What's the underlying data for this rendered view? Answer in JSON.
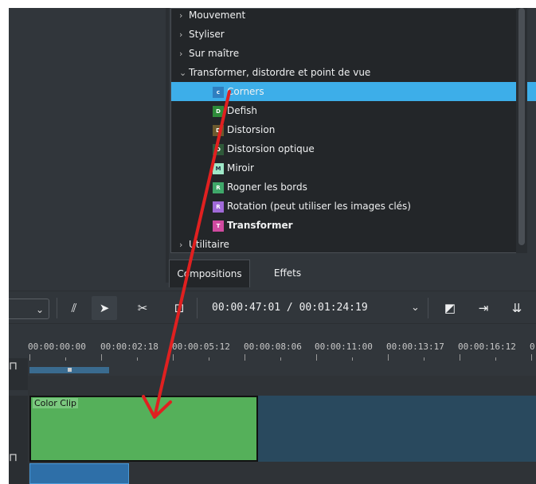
{
  "effects_tree": {
    "categories_top": [
      {
        "label": "Mouvement"
      },
      {
        "label": "Styliser"
      },
      {
        "label": "Sur maître"
      },
      {
        "label": "Transformer, distordre et point de vue"
      }
    ],
    "items": [
      {
        "label": "Corners",
        "icon_text": "c",
        "icon_color": "#2f7fc0",
        "selected": true
      },
      {
        "label": "Defish",
        "icon_text": "D",
        "icon_color": "#2e8b3a"
      },
      {
        "label": "Distorsion",
        "icon_text": "D",
        "icon_color": "#6b5a2e"
      },
      {
        "label": "Distorsion optique",
        "icon_text": "D",
        "icon_color": "#2f5a3a"
      },
      {
        "label": "Miroir",
        "icon_text": "M",
        "icon_color": "#9fe8c8"
      },
      {
        "label": "Rogner les bords",
        "icon_text": "R",
        "icon_color": "#3fa86a"
      },
      {
        "label": "Rotation (peut utiliser les images clés)",
        "icon_text": "R",
        "icon_color": "#a06ad8"
      },
      {
        "label": "Transformer",
        "icon_text": "T",
        "icon_color": "#d04aa0",
        "bold": true
      }
    ],
    "categories_bottom": [
      {
        "label": "Utilitaire"
      }
    ]
  },
  "tabs": [
    {
      "label": "Compositions",
      "active": true
    },
    {
      "label": "Effets",
      "active": false
    }
  ],
  "toolbar": {
    "timecode": "00:00:47:01 / 00:01:24:19"
  },
  "ruler": {
    "ticks": [
      "00:00:00:00",
      "00:00:02:18",
      "00:00:05:12",
      "00:00:08:06",
      "00:00:11:00",
      "00:00:13:17",
      "00:00:16:12",
      "0"
    ]
  },
  "timeline": {
    "clip_label": "Color Clip"
  },
  "colors": {
    "selection": "#3daee9",
    "clip_green": "#55b05a",
    "annotation_arrow": "#e02020"
  }
}
